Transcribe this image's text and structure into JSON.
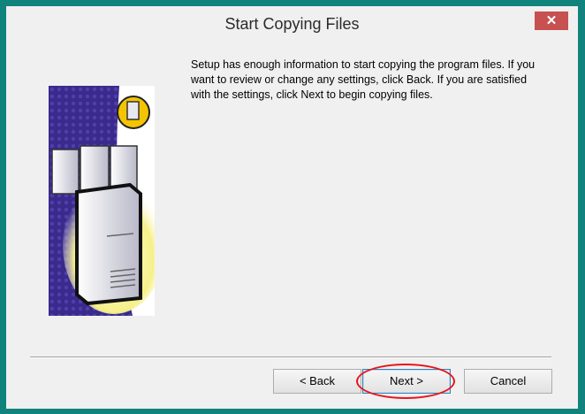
{
  "window": {
    "title": "Start Copying Files",
    "close_label": "✕"
  },
  "body": {
    "description": "Setup has enough information to start copying the program files.  If you want to review or change any settings, click Back.  If you are satisfied with the settings, click Next to begin copying files."
  },
  "buttons": {
    "back_label": "< Back",
    "next_label": "Next >",
    "cancel_label": "Cancel"
  },
  "colors": {
    "desktop": "#10847c",
    "dialog": "#f0f0f0",
    "close_button": "#c75050",
    "annotation_circle": "#e8141c",
    "image_background": "#3a2a8c"
  }
}
